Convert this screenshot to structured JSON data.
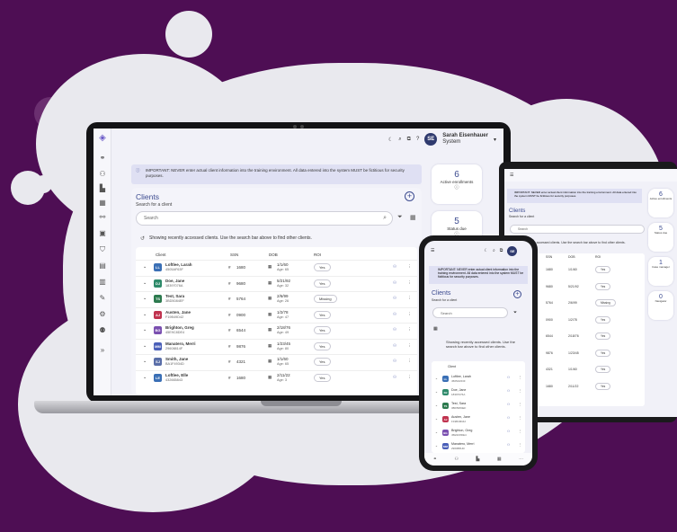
{
  "colors": {
    "background": "#4e0e54",
    "accent": "#3b4a8f",
    "avatar": "#2f3a6e"
  },
  "user": {
    "initials": "SE",
    "name": "Sarah Eisenhauer",
    "role": "System"
  },
  "notice": "IMPORTANT: NEVER enter actual client information into the training environment. All data entered into the system MUST be fictitious for security purposes.",
  "clients": {
    "title": "Clients",
    "subtitle": "Search for a client",
    "search_placeholder": "Search",
    "recent_msg": "Showing recently accessed clients. Use the search bar above to find other clients."
  },
  "columns": {
    "client": "Client",
    "ssn": "SSN",
    "dob": "DOB",
    "roi": "ROI"
  },
  "rows": [
    {
      "name": "Loftlee, Larah",
      "id": "4505AF63F",
      "initials": "LL",
      "color": "#3a6fb5",
      "ssn": "1680",
      "dob": "1/1/60",
      "age": "Age: 65",
      "roi": "Yes"
    },
    {
      "name": "Doe, Jane",
      "id": "18397076A",
      "initials": "DJ",
      "color": "#2e8a6a",
      "ssn": "9680",
      "dob": "5/21/92",
      "age": "Age: 32",
      "roi": "Yes"
    },
    {
      "name": "Test, Sara",
      "id": "3BD5084EF",
      "initials": "TS",
      "color": "#2c7a4e",
      "ssn": "5764",
      "dob": "2/6/99",
      "age": "Age: 26",
      "roi": "Missing"
    },
    {
      "name": "Austen, Jane",
      "id": "F19B49D42",
      "initials": "AJ",
      "color": "#c0334f",
      "ssn": "0900",
      "dob": "1/2/78",
      "age": "Age: 47",
      "roi": "Yes"
    },
    {
      "name": "Brighton, Greg",
      "id": "45E9C8DE4",
      "initials": "BG",
      "color": "#7a4fb0",
      "ssn": "6544",
      "dob": "2/18/76",
      "age": "Age: 49",
      "roi": "Yes"
    },
    {
      "name": "Manatero, Merri",
      "id": "29608814F",
      "initials": "MM",
      "color": "#4a5fb8",
      "ssn": "9876",
      "dob": "1/23/45",
      "age": "Age: 80",
      "roi": "Yes"
    },
    {
      "name": "Smith, Jane",
      "id": "BA1F4934D",
      "initials": "SJ",
      "color": "#5a6ea8",
      "ssn": "4321",
      "dob": "1/1/60",
      "age": "Age: 65",
      "roi": "Yes"
    },
    {
      "name": "Loftlee, Elle",
      "id": "432665843",
      "initials": "LE",
      "color": "#3a6fb5",
      "ssn": "1680",
      "dob": "2/11/22",
      "age": "Age: 3",
      "roi": "Yes"
    }
  ],
  "stats": [
    {
      "value": "6",
      "label": "Active enrollments"
    },
    {
      "value": "5",
      "label": "Status due"
    },
    {
      "value": "1",
      "label": "Case manager"
    },
    {
      "value": "0",
      "label": "Navigator"
    }
  ]
}
